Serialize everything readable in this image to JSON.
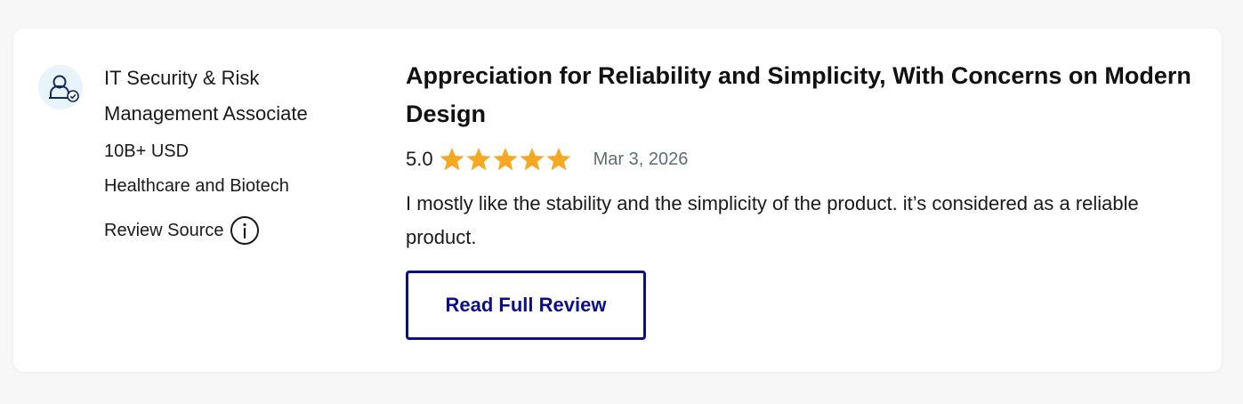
{
  "reviewer": {
    "avatar_icon": "user-verified-icon",
    "job_title": "IT Security & Risk Management Associate",
    "company_size": "10B+ USD",
    "industry": "Healthcare and Biotech",
    "review_source_label": "Review Source",
    "info_icon": "info-circle-icon"
  },
  "review": {
    "title": "Appreciation for Reliability and Simplicity, With Concerns on Modern Design",
    "rating": "5.0",
    "rating_value": 5,
    "rating_max": 5,
    "date": "Mar 3, 2026",
    "text": "I mostly like the stability and the simplicity of the product. it’s considered as a reliable product.",
    "read_full_label": "Read Full Review"
  },
  "colors": {
    "star": "#f7a823",
    "button_accent": "#0b0f86",
    "avatar_bg": "#e8f3fb",
    "date_text": "#5f6b73"
  }
}
